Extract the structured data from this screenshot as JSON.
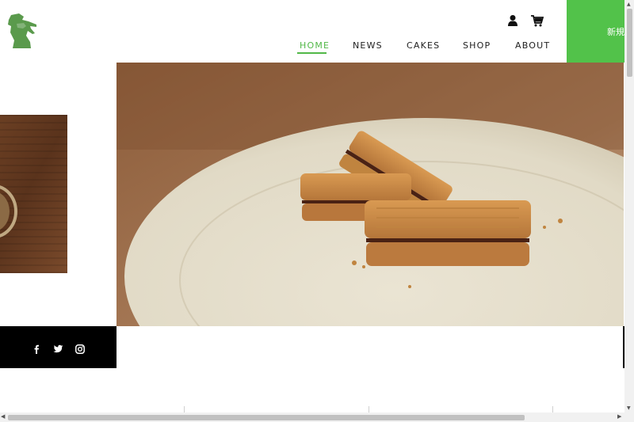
{
  "brand": {
    "logo_icon": "girl-silhouette-logo",
    "color": "#5a9a4c"
  },
  "header": {
    "icons": [
      "account-icon",
      "cart-icon"
    ],
    "nav": [
      {
        "label": "HOME",
        "active": true
      },
      {
        "label": "NEWS"
      },
      {
        "label": "CAKES"
      },
      {
        "label": "SHOP"
      },
      {
        "label": "ABOUT"
      }
    ],
    "register_label": "新規登録"
  },
  "hero": {
    "subject": "sandwich cookies on ceramic plate"
  },
  "social": {
    "icons": [
      "facebook-icon",
      "twitter-icon",
      "instagram-icon"
    ]
  },
  "colors": {
    "accent": "#52c24a",
    "nav_active": "#52b848",
    "text": "#222222"
  }
}
